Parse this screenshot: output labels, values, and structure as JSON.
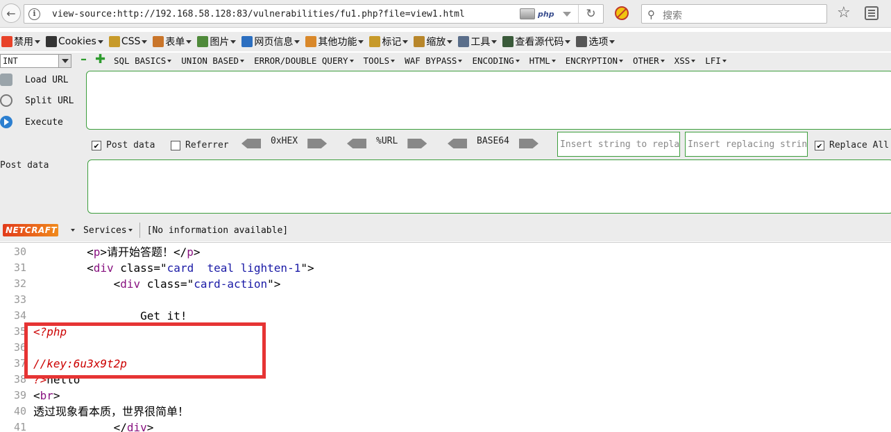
{
  "nav": {
    "url": "view-source:http://192.168.58.128:83/vulnerabilities/fu1.php?file=view1.html",
    "php_badge": "php",
    "search_placeholder": "搜索"
  },
  "menubar": {
    "items": [
      {
        "label": "禁用",
        "icon": "forbidden-icon",
        "color": "#e8432a"
      },
      {
        "label": "Cookies",
        "icon": "user-icon",
        "color": "#333333"
      },
      {
        "label": "CSS",
        "icon": "pencil-icon",
        "color": "#c79a2a"
      },
      {
        "label": "表单",
        "icon": "form-icon",
        "color": "#c9752a"
      },
      {
        "label": "图片",
        "icon": "image-icon",
        "color": "#4f8a3a"
      },
      {
        "label": "网页信息",
        "icon": "info-icon",
        "color": "#2c6fc0"
      },
      {
        "label": "其他功能",
        "icon": "misc-icon",
        "color": "#d9882a"
      },
      {
        "label": "标记",
        "icon": "marker-icon",
        "color": "#c79a2a"
      },
      {
        "label": "缩放",
        "icon": "ruler-icon",
        "color": "#b8862a"
      },
      {
        "label": "工具",
        "icon": "tools-icon",
        "color": "#5a6e8a"
      },
      {
        "label": "查看源代码",
        "icon": "source-icon",
        "color": "#3a5a3a"
      },
      {
        "label": "选项",
        "icon": "options-icon",
        "color": "#555555"
      }
    ]
  },
  "hackbar": {
    "type_select": "INT",
    "menus": [
      "SQL BASICS",
      "UNION BASED",
      "ERROR/DOUBLE QUERY",
      "TOOLS",
      "WAF BYPASS",
      "ENCODING",
      "HTML",
      "ENCRYPTION",
      "OTHER",
      "XSS",
      "LFI"
    ],
    "load_url": "Load URL",
    "split_url": "Split URL",
    "execute": "Execute",
    "post_data_check": "Post data",
    "post_data_checked": true,
    "referrer_check": "Referrer",
    "referrer_checked": false,
    "enc_hex": "0xHEX",
    "enc_url": "%URL",
    "enc_b64": "BASE64",
    "insert_string_placeholder": "Insert string to repla",
    "insert_replacing_placeholder": "Insert replacing strin",
    "replace_all": "Replace All",
    "replace_all_checked": true,
    "post_data_label": "Post data"
  },
  "netcraft": {
    "logo": "NETCRAFT",
    "services": "Services",
    "info": "[No information available]"
  },
  "source": {
    "lines": [
      {
        "n": "30",
        "parts": [
          {
            "t": "        ",
            "c": "attr"
          },
          {
            "t": "<",
            "c": "attr"
          },
          {
            "t": "p",
            "c": "tag"
          },
          {
            "t": ">请开始答题！</",
            "c": "attr"
          },
          {
            "t": "p",
            "c": "tag"
          },
          {
            "t": ">",
            "c": "attr"
          }
        ]
      },
      {
        "n": "31",
        "parts": [
          {
            "t": "        <",
            "c": "attr"
          },
          {
            "t": "div",
            "c": "tag"
          },
          {
            "t": " class=\"",
            "c": "attr"
          },
          {
            "t": "card  teal lighten-1",
            "c": "val"
          },
          {
            "t": "\">",
            "c": "attr"
          }
        ]
      },
      {
        "n": "32",
        "parts": [
          {
            "t": "            <",
            "c": "attr"
          },
          {
            "t": "div",
            "c": "tag"
          },
          {
            "t": " class=\"",
            "c": "attr"
          },
          {
            "t": "card-action",
            "c": "val"
          },
          {
            "t": "\">",
            "c": "attr"
          }
        ]
      },
      {
        "n": "33",
        "parts": []
      },
      {
        "n": "34",
        "parts": [
          {
            "t": "                Get it!",
            "c": "attr"
          }
        ]
      },
      {
        "n": "35",
        "parts": [
          {
            "t": "<?php",
            "c": "php"
          }
        ]
      },
      {
        "n": "36",
        "parts": []
      },
      {
        "n": "37",
        "parts": [
          {
            "t": "//key:6u3x9t2p",
            "c": "php"
          }
        ]
      },
      {
        "n": "38",
        "parts": [
          {
            "t": "?>",
            "c": "php"
          },
          {
            "t": "hello",
            "c": "attr"
          }
        ]
      },
      {
        "n": "39",
        "parts": [
          {
            "t": "<",
            "c": "attr"
          },
          {
            "t": "br",
            "c": "tag"
          },
          {
            "t": ">",
            "c": "attr"
          }
        ]
      },
      {
        "n": "40",
        "parts": [
          {
            "t": "透过现象看本质，世界很简单！",
            "c": "attr"
          }
        ]
      },
      {
        "n": "41",
        "parts": [
          {
            "t": "            </",
            "c": "attr"
          },
          {
            "t": "div",
            "c": "tag"
          },
          {
            "t": ">",
            "c": "attr"
          }
        ]
      }
    ]
  }
}
